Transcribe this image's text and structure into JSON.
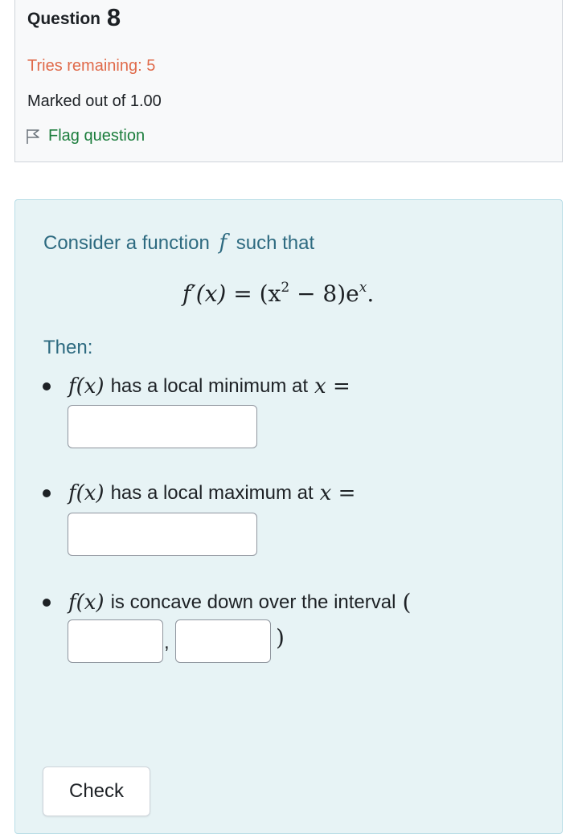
{
  "info": {
    "question_label": "Question",
    "question_number": "8",
    "tries_remaining": "Tries remaining: 5",
    "marked_out_of": "Marked out of 1.00",
    "flag_label": "Flag question",
    "flag_icon": "flag-outline-icon"
  },
  "content": {
    "intro_prefix": "Consider a function",
    "intro_var": "f",
    "intro_suffix": "such that",
    "formula": {
      "lhs": "f′(x)",
      "rhs_open": "= (x",
      "exponent": "2",
      "rhs_mid": " − 8)e",
      "exponent_e": "x",
      "rhs_end": "."
    },
    "then": "Then:",
    "items": [
      {
        "fx": "f(x)",
        "text": "has a local minimum at",
        "eq": "x ="
      },
      {
        "fx": "f(x)",
        "text": "has a local maximum at",
        "eq": "x ="
      },
      {
        "fx": "f(x)",
        "text": "is concave down over the interval",
        "open_paren": "("
      }
    ],
    "comma": ",",
    "close_paren": ")",
    "check_label": "Check"
  },
  "colors": {
    "tries": "#e06a4a",
    "flag": "#1b7d3c",
    "teal_text": "#2d6a80",
    "content_bg": "#e7f3f5"
  }
}
